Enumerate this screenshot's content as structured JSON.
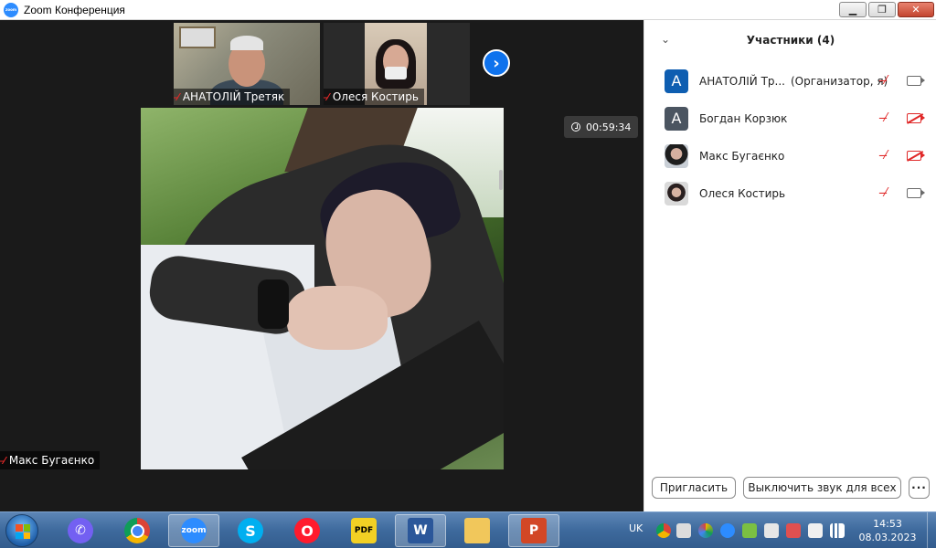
{
  "window": {
    "title": "Zoom Конференция",
    "logo_text": "zoom"
  },
  "thumbnails": [
    {
      "name": "АНАТОЛІЙ Третяк"
    },
    {
      "name": "Олеся Костирь"
    }
  ],
  "main_speaker": {
    "name": "Макс Бугаєнко"
  },
  "timer": "00:59:34",
  "participants_panel": {
    "title": "Участники (4)",
    "participants": [
      {
        "name": "АНАТОЛІЙ Тр...",
        "role": "(Организатор, я)",
        "avatar_letter": "A",
        "mic": "muted",
        "camera": "on"
      },
      {
        "name": "Богдан Корзюк",
        "avatar_letter": "A",
        "mic": "muted",
        "camera": "off"
      },
      {
        "name": "Макс Бугаєнко",
        "avatar_letter": "",
        "mic": "muted",
        "camera": "off"
      },
      {
        "name": "Олеся Костирь",
        "avatar_letter": "",
        "mic": "muted",
        "camera": "on"
      }
    ],
    "invite_label": "Пригласить",
    "mute_all_label": "Выключить звук для всех",
    "more_label": "···"
  },
  "taskbar": {
    "apps": [
      "viber",
      "chrome",
      "zoom",
      "skype",
      "opera",
      "pdf",
      "word",
      "explorer",
      "powerpoint"
    ],
    "zoom_label": "zoom",
    "pdf_label": "PDF",
    "word_label": "W",
    "ppt_label": "P",
    "skype_label": "S",
    "opera_label": "O",
    "language": "UK",
    "time": "14:53",
    "date": "08.03.2023"
  },
  "colors": {
    "accent": "#0e72ed",
    "muted_red": "#e02828",
    "video_bg": "#1a1a1a"
  }
}
